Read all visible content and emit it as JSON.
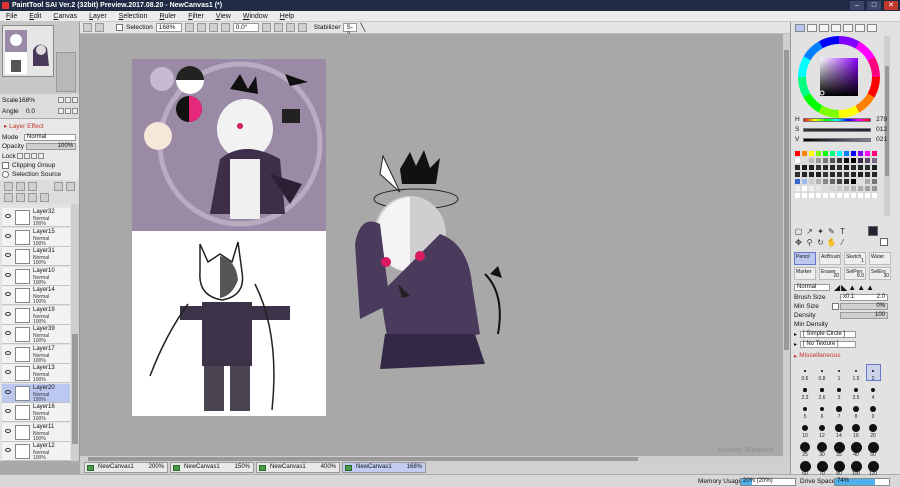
{
  "window": {
    "title": "PaintTool SAI Ver.2 (32bit) Preview.2017.08.20 - NewCanvas1 (*)"
  },
  "menu": [
    "File",
    "Edit",
    "Canvas",
    "Layer",
    "Selection",
    "Ruler",
    "Filter",
    "View",
    "Window",
    "Help"
  ],
  "toolbar": {
    "selection_label": "Selection",
    "zoom": "168%",
    "angle": "0.0°",
    "stabilizer_label": "Stabilizer",
    "stabilizer_value": "S-2"
  },
  "navigator": {
    "scale_label": "Scale",
    "scale_value": "168%",
    "angle_label": "Angle",
    "angle_value": "0.0"
  },
  "layer_panel": {
    "effect_header": "Layer Effect",
    "mode_label": "Mode",
    "mode_value": "Normal",
    "opacity_label": "Opacity",
    "opacity_value": "100%",
    "lock_label": "Lock",
    "clipping_label": "Clipping Group",
    "selection_source_label": "Selection Source"
  },
  "layers": [
    {
      "name": "Layer32",
      "mode": "Normal",
      "opacity": "100%",
      "selected": false
    },
    {
      "name": "Layer15",
      "mode": "Normal",
      "opacity": "100%",
      "selected": false
    },
    {
      "name": "Layer31",
      "mode": "Normal",
      "opacity": "100%",
      "selected": false
    },
    {
      "name": "Layer10",
      "mode": "Normal",
      "opacity": "100%",
      "selected": false
    },
    {
      "name": "Layer14",
      "mode": "Normal",
      "opacity": "100%",
      "selected": false
    },
    {
      "name": "Layer19",
      "mode": "Normal",
      "opacity": "100%",
      "selected": false
    },
    {
      "name": "Layer39",
      "mode": "Normal",
      "opacity": "100%",
      "selected": false
    },
    {
      "name": "Layer17",
      "mode": "Normal",
      "opacity": "100%",
      "selected": false
    },
    {
      "name": "Layer13",
      "mode": "Normal",
      "opacity": "100%",
      "selected": false
    },
    {
      "name": "Layer20",
      "mode": "Normal",
      "opacity": "100%",
      "selected": true
    },
    {
      "name": "Layer16",
      "mode": "Normal",
      "opacity": "100%",
      "selected": false
    },
    {
      "name": "Layer11",
      "mode": "Normal",
      "opacity": "100%",
      "selected": false
    },
    {
      "name": "Layer12",
      "mode": "Normal",
      "opacity": "100%",
      "selected": false
    }
  ],
  "canvas": {
    "watermark": "Activate Windows",
    "watermark_sub": "Go to Settings to activate Windows."
  },
  "canvas_tabs": [
    {
      "name": "NewCanvas1",
      "zoom": "200%",
      "active": false
    },
    {
      "name": "NewCanvas1",
      "zoom": "150%",
      "active": false
    },
    {
      "name": "NewCanvas1",
      "zoom": "400%",
      "active": false
    },
    {
      "name": "NewCanvas1",
      "zoom": "168%",
      "active": true
    }
  ],
  "status": {
    "memory_label": "Memory Usage",
    "memory_value": "20% (20%)",
    "memory_fraction": 0.2,
    "drive_label": "Drive Space",
    "drive_value": "74%",
    "drive_fraction": 0.74
  },
  "color": {
    "current": "#2a2135",
    "h_label": "H",
    "h_value": "279",
    "s_label": "S",
    "s_value": "012",
    "v_label": "V",
    "v_value": "021",
    "swatches": [
      "#ff0000",
      "#ff8000",
      "#ffff00",
      "#80ff00",
      "#00ff00",
      "#00ff80",
      "#00ffff",
      "#0080ff",
      "#0000ff",
      "#8000ff",
      "#ff00ff",
      "#ff0080",
      "#ffffff",
      "#dddddd",
      "#bbbbbb",
      "#999999",
      "#777777",
      "#555555",
      "#333333",
      "#111111",
      "#000000",
      "#3a2a4a",
      "#5a4a6a",
      "#7a6a8a",
      "#2a2a2a",
      "#1a1a1a",
      "#222222",
      "#333333",
      "#2b2b2b",
      "#262626",
      "#303030",
      "#1d1d1d",
      "#282828",
      "#242424",
      "#2e2e2e",
      "#202020",
      "#2c2c2c",
      "#272727",
      "#222222",
      "#1f1f1f",
      "#353535",
      "#292929",
      "#2d2d2d",
      "#313131",
      "#232323",
      "#1e1e1e",
      "#2a2a2a",
      "#262626",
      "#3366cc",
      "#99bbee",
      "#cccccc",
      "#b0b0b0",
      "#888888",
      "#666666",
      "#444444",
      "#222222",
      "#000000",
      "#dddddd",
      "#aaaaaa",
      "#777777",
      "#eeeeee",
      "#ffffff",
      "#f0f0f0",
      "#e6e6e6",
      "#dcdcdc",
      "#d2d2d2",
      "#c8c8c8",
      "#bebebe",
      "#b4b4b4",
      "#aaaaaa",
      "#a0a0a0",
      "#969696",
      "#ffffff",
      "#ffffff",
      "#ffffff",
      "#ffffff",
      "#ffffff",
      "#ffffff",
      "#ffffff",
      "#ffffff",
      "#ffffff",
      "#ffffff",
      "#ffffff",
      "#ffffff"
    ]
  },
  "brush_tools": [
    {
      "name": "Pencil",
      "size": "",
      "active": true
    },
    {
      "name": "AirBrush",
      "size": "",
      "active": false
    },
    {
      "name": "Sketch",
      "size": "1",
      "active": false
    },
    {
      "name": "Water",
      "size": "",
      "active": false
    },
    {
      "name": "Marker",
      "size": "",
      "active": false
    },
    {
      "name": "Eraser",
      "size": "20",
      "active": false
    },
    {
      "name": "SelPen",
      "size": "8.0",
      "active": false
    },
    {
      "name": "SelErs",
      "size": "30",
      "active": false
    }
  ],
  "brush_settings": {
    "mode_value": "Normal",
    "size_label": "Brush Size",
    "size_mult": "x0.1",
    "size_value": "2.0",
    "minsize_label": "Min Size",
    "minsize_value": "0%",
    "density_label": "Density",
    "density_value": "100",
    "mindensity_label": "Min Density",
    "shape_value": "[ Simple Circle ]",
    "texture_value": "[ No Texture ]",
    "misc_label": "Miscellaneous"
  },
  "brush_sizes": [
    "0.6",
    "0.8",
    "1",
    "1.5",
    "2",
    "2.3",
    "2.6",
    "3",
    "3.5",
    "4",
    "5",
    "6",
    "7",
    "8",
    "9",
    "10",
    "12",
    "14",
    "16",
    "20",
    "25",
    "30",
    "35",
    "40",
    "50",
    "60",
    "70",
    "80",
    "100",
    "120"
  ]
}
